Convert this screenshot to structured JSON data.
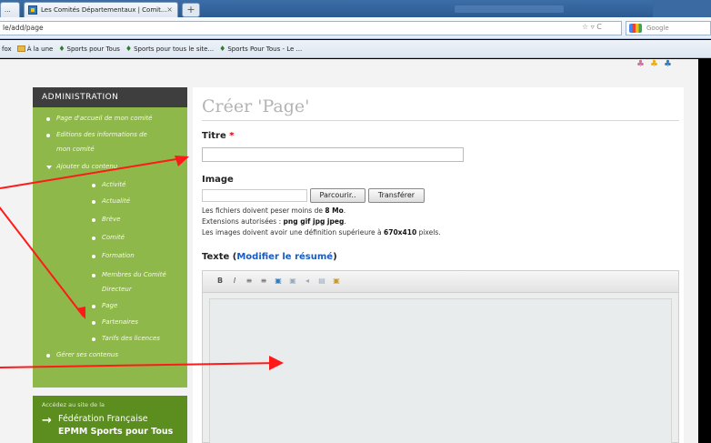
{
  "browser": {
    "tab_prev_label": "...",
    "tab_title": "Les Comités Départementaux | Comit...",
    "new_tab": "+",
    "url": "le/add/page",
    "url_icons": "☆ ▿ C",
    "search_placeholder": "Google",
    "bookmarks": [
      "fox",
      "À la une",
      "Sports pour Tous",
      "Sports pour tous le site...",
      "Sports Pour Tous - Le ..."
    ]
  },
  "sidebar": {
    "heading": "ADMINISTRATION",
    "items": [
      "Page d'accueil de mon comité",
      "Editions des informations de",
      "mon comité",
      "Ajouter du contenu",
      "Activité",
      "Actualité",
      "Brève",
      "Comité",
      "Formation",
      "Membres du Comité",
      "Directeur",
      "Page",
      "Partenaires",
      "Tarifs des licences",
      "Gérer ses contenus"
    ]
  },
  "promo": {
    "small": "Accédez au site de la",
    "line1": "Fédération Française",
    "line2": "EPMM Sports pour Tous"
  },
  "main": {
    "page_title": "Créer 'Page'",
    "titre_label": "Titre",
    "required_mark": "*",
    "image_label": "Image",
    "browse_button": "Parcourir..",
    "upload_button": "Transférer",
    "help_size_prefix": "Les fichiers doivent peser moins de",
    "help_size_value": "8 Mo",
    "help_ext_prefix": "Extensions autorisées :",
    "help_ext_value": "png gif jpg jpeg",
    "help_dim_prefix": "Les images doivent avoir une définition supérieure à",
    "help_dim_value": "670x410",
    "help_dim_suffix": "pixels.",
    "texte_label": "Texte",
    "resume_link": "Modifier le résumé",
    "toolbar": [
      "B",
      "I",
      "≡",
      "≡",
      "▣",
      "▣",
      "◂",
      "▤",
      "▣"
    ]
  },
  "colors": {
    "sidebar_green": "#8fb84a",
    "sidebar_head": "#3e3e3e",
    "promo_green": "#5c8e1f",
    "arrow_red": "#ff1a1a",
    "link_blue": "#1a5bbf"
  }
}
